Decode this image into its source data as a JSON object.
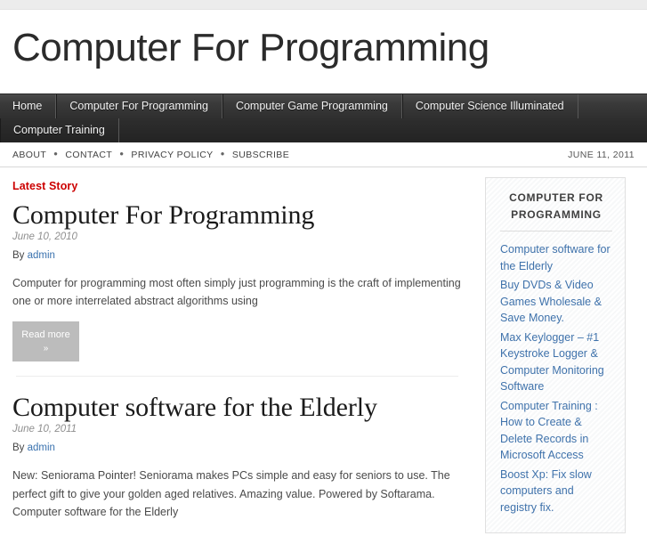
{
  "site": {
    "title": "Computer For Programming"
  },
  "main_nav": {
    "items": [
      {
        "label": "Home"
      },
      {
        "label": "Computer For Programming"
      },
      {
        "label": "Computer Game Programming"
      },
      {
        "label": "Computer Science Illuminated"
      },
      {
        "label": "Computer Training"
      }
    ]
  },
  "sub_nav": {
    "items": [
      {
        "label": "ABOUT"
      },
      {
        "label": "CONTACT"
      },
      {
        "label": "PRIVACY POLICY"
      },
      {
        "label": "SUBSCRIBE"
      }
    ],
    "separator": "●",
    "date": "JUNE 11, 2011"
  },
  "content": {
    "latest_label": "Latest Story",
    "posts": [
      {
        "title": "Computer For Programming",
        "date": "June 10, 2010",
        "by_prefix": "By",
        "author": "admin",
        "excerpt": "Computer for programming most often simply just programming is the craft of implementing one or more interrelated abstract algorithms using",
        "read_more_label": "Read more",
        "read_more_chevron": "»"
      },
      {
        "title": "Computer software for the Elderly",
        "date": "June 10, 2011",
        "by_prefix": "By",
        "author": "admin",
        "excerpt": "New: Seniorama Pointer! Seniorama makes PCs simple and easy for seniors to use. The perfect gift to give your golden aged relatives. Amazing value. Powered by Softarama. Computer software for the Elderly"
      }
    ]
  },
  "sidebar": {
    "widget_title": "COMPUTER FOR PROGRAMMING",
    "links": [
      {
        "label": "Computer software for the Elderly"
      },
      {
        "label": "Buy DVDs & Video Games Wholesale & Save Money."
      },
      {
        "label": "Max Keylogger – #1 Keystroke Logger & Computer Monitoring Software"
      },
      {
        "label": "Computer Training : How to Create & Delete Records in Microsoft Access"
      },
      {
        "label": "Boost Xp: Fix slow computers and registry fix."
      }
    ]
  },
  "colors": {
    "accent_red": "#cc0000",
    "link_blue": "#3f72ab",
    "nav_dark": "#2d2d2d"
  }
}
